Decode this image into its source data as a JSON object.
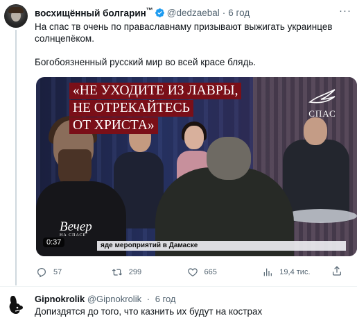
{
  "tweet": {
    "author_name": "восхищённый болгарин",
    "author_name_suffix": "™",
    "handle": "@dedzaebal",
    "separator": "·",
    "time": "6 год",
    "more": "···",
    "paragraphs": [
      "На спас тв очень по праваславнаму призывают выжигать украинцев солнцепёком.",
      "Богобоязненный русский мир во всей красе блядь."
    ],
    "media": {
      "quote_lines": [
        "«НЕ УХОДИТЕ ИЗ ЛАВРЫ,",
        "НЕ ОТРЕКАЙТЕСЬ",
        "ОТ ХРИСТА»"
      ],
      "channel_logo_text": "СПАС",
      "show_name": "Вечер",
      "show_subtitle": "НА СПАСЕ",
      "ticker": "яде мероприятий в Дамаске",
      "duration": "0:37"
    },
    "actions": {
      "replies": "57",
      "retweets": "299",
      "likes": "665",
      "views": "19,4 тис."
    }
  },
  "reply": {
    "author_name": "Gipnokrolik",
    "handle": "@Gipnokrolik",
    "separator": "·",
    "time": "6 год",
    "text": "Допиздятся до того, что казнить их будут на кострах"
  },
  "colors": {
    "text_primary": "#0f1419",
    "text_secondary": "#536471",
    "verified_blue": "#1d9bf0",
    "quote_bg": "#7a0f18"
  }
}
